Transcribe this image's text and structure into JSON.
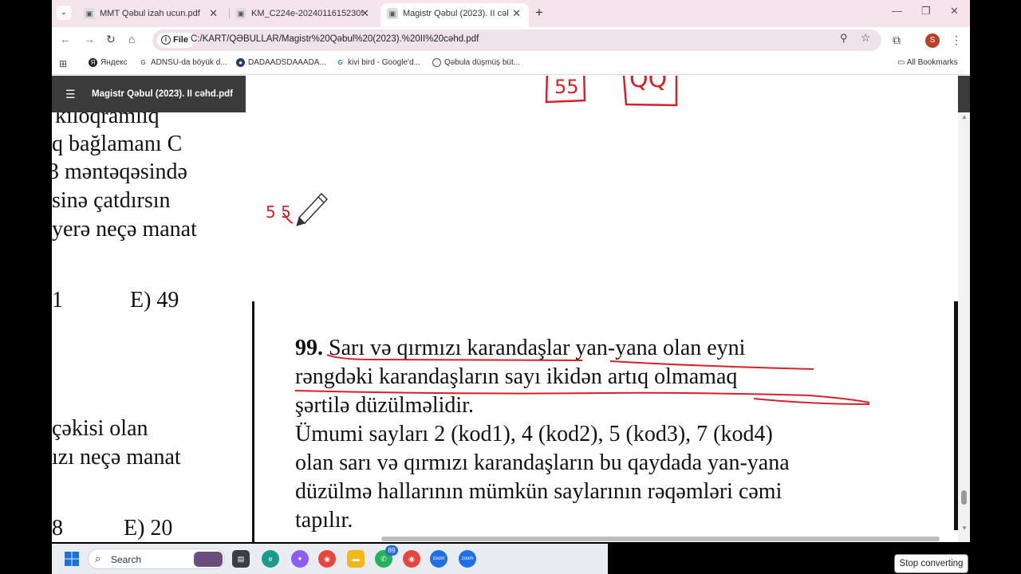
{
  "tabs": [
    {
      "label": "MMT Qəbul izah ucun.pdf",
      "active": false
    },
    {
      "label": "KM_C224e-20240116152305",
      "active": false
    },
    {
      "label": "Magistr Qəbul (2023). II cəhd.pc",
      "active": true
    }
  ],
  "address": {
    "chip_label": "File",
    "url": "C:/KART/QƏBULLAR/Magistr%20Qəbul%20(2023).%20II%20cəhd.pdf"
  },
  "bookmarks": [
    {
      "label": "Яндекс",
      "icon": "yandex-icon"
    },
    {
      "label": "ADNSU-da böyük d...",
      "icon": "google-icon"
    },
    {
      "label": "DADAADSDAAADA...",
      "icon": "site-icon"
    },
    {
      "label": "kivi bird - Google'd...",
      "icon": "google-icon"
    },
    {
      "label": "Qəbula düşmüş büt...",
      "icon": "site-icon"
    }
  ],
  "all_bookmarks_label": "All Bookmarks",
  "profile_initial": "S",
  "pdf": {
    "title": "Magistr Qəbul (2023). II cəhd.pdf",
    "left_page_lines": [
      "kiloqramlıq",
      "q bağlamanı C",
      "3 məntəqəsində",
      "sinə çatdırsın",
      "yerə neçə manat",
      "1",
      "E) 49",
      "çəkisi olan",
      "ızı neçə manat",
      "8",
      "E) 20"
    ],
    "question": {
      "number": "99.",
      "lines": [
        " Sarı və qırmızı karandaşlar yan-yana olan eyni",
        "rəngdəki karandaşların sayı ikidən artıq olmamaq",
        "şərtilə düzülməlidir.",
        "Ümumi sayları 2 (kod1), 4 (kod2), 5 (kod3), 7 (kod4)",
        "olan sarı və qırmızı karandaşların bu qaydada yan-yana",
        "düzülmə hallarının mümkün saylarının rəqəmləri cəmi",
        "tapılır."
      ]
    },
    "annotations": {
      "box1": "55",
      "box2": "QQ",
      "note": "5 5"
    }
  },
  "taskbar": {
    "search_label": "Search",
    "whatsapp_badge": "89",
    "zoom_label": "zoom"
  },
  "stop_button": "Stop converting"
}
